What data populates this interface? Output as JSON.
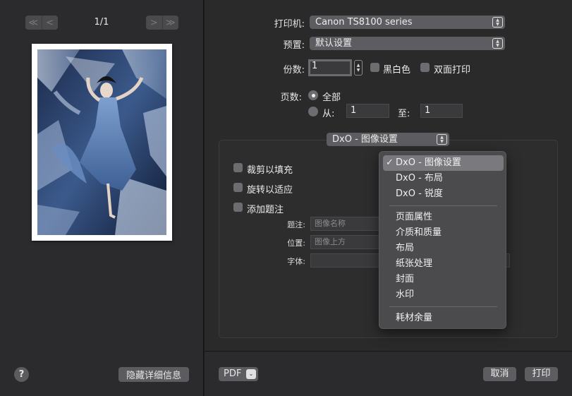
{
  "preview": {
    "nav_first": "≪",
    "nav_prev": "<",
    "nav_next": ">",
    "nav_last": "≫",
    "page_count": "1/1",
    "help_label": "?",
    "hide_details_label": "隐藏详细信息"
  },
  "settings": {
    "printer_label": "打印机:",
    "printer_value": "Canon TS8100 series",
    "preset_label": "预置:",
    "preset_value": "默认设置",
    "copies_label": "份数:",
    "copies_value": "1",
    "bw_label": "黑白色",
    "duplex_label": "双面打印",
    "pages_label": "页数:",
    "pages_all_label": "全部",
    "pages_from_label": "从:",
    "pages_from_value": "1",
    "pages_to_label": "至:",
    "pages_to_value": "1",
    "section_popup_value": "DxO - 图像设置"
  },
  "image_settings": {
    "crop_fill_label": "裁剪以填充",
    "rotate_fit_label": "旋转以适应",
    "add_caption_label": "添加题注",
    "caption_label": "题注:",
    "caption_placeholder": "图像名称",
    "position_label": "位置:",
    "position_value": "图像上方",
    "font_label": "字体:"
  },
  "menu": {
    "checkmark": "✓",
    "items": [
      "DxO - 图像设置",
      "DxO - 布局",
      "DxO - 锐度",
      "页面属性",
      "介质和质量",
      "布局",
      "纸张处理",
      "封面",
      "水印",
      "耗材余量"
    ]
  },
  "bottom": {
    "pdf_label": "PDF",
    "pdf_chevron": "⌄",
    "cancel_label": "取消",
    "print_label": "打印"
  },
  "colors": {
    "window_bg": "#2a2a2a",
    "control_bg": "#5d5d61",
    "menu_highlight": "#7a7a7e"
  }
}
